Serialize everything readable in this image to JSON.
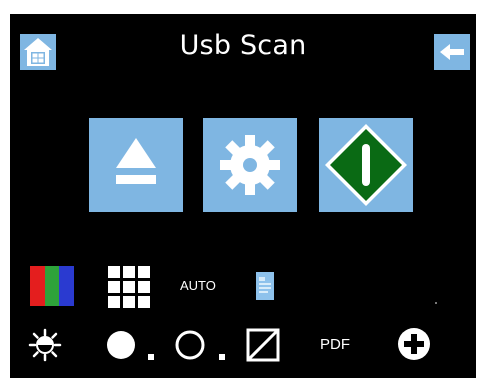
{
  "app": {
    "title": "Usb Scan"
  },
  "buttons": {
    "home": {
      "icon": "home-icon"
    },
    "back": {
      "icon": "arrow-left-icon"
    },
    "eject": {
      "icon": "eject-icon"
    },
    "settings": {
      "icon": "gear-icon"
    },
    "start": {
      "icon": "start-diamond-icon"
    }
  },
  "options": {
    "color_mode": {
      "icon": "rgb-color-icon"
    },
    "resolution": {
      "icon": "grid-icon"
    },
    "auto_label": "AUTO",
    "document": {
      "icon": "document-icon"
    },
    "brightness": {
      "icon": "brightness-icon"
    },
    "density_dark": {
      "icon": "filled-circle-icon"
    },
    "density_light": {
      "icon": "outline-circle-icon"
    },
    "contrast": {
      "icon": "contrast-icon"
    },
    "format_label": "PDF",
    "more": {
      "icon": "plus-circle-icon"
    }
  },
  "colors": {
    "accent": "#7fb6e2",
    "background": "#000000",
    "start_green": "#0a6a14",
    "text": "#ffffff"
  }
}
